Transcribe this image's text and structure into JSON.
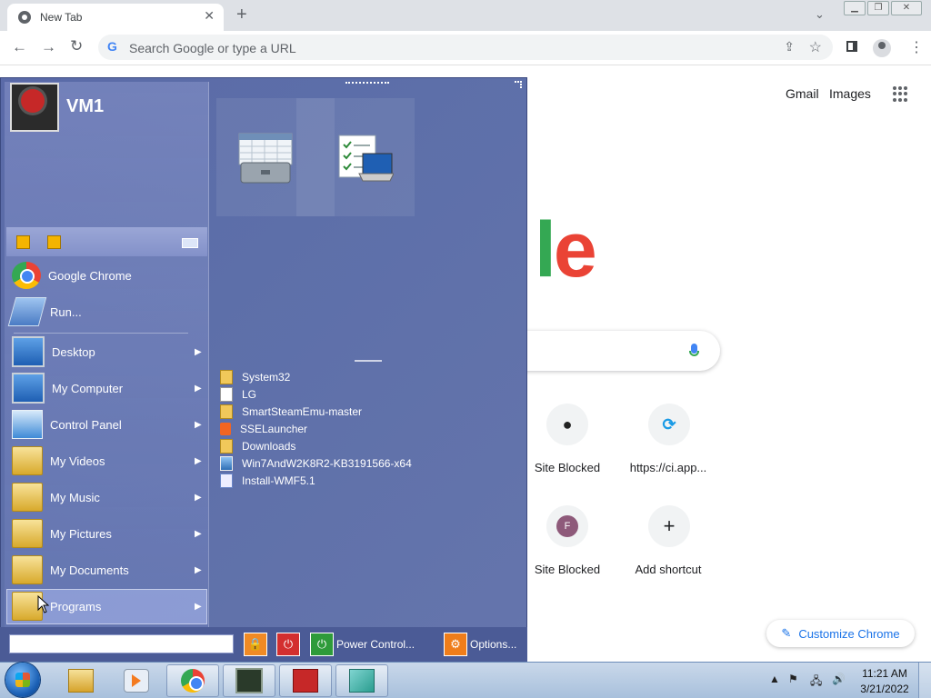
{
  "browser": {
    "tab_title": "New Tab",
    "new_tab": "+",
    "omnibox_placeholder": "Search Google or type a URL"
  },
  "google": {
    "links": [
      "Gmail",
      "Images"
    ],
    "logo_visible": "le",
    "shortcuts": [
      {
        "label": "Site Blocked",
        "icon": "github-icon"
      },
      {
        "label": "https://ci.app...",
        "icon": "app-icon"
      },
      {
        "label": "Site Blocked",
        "icon": "F"
      },
      {
        "label": "Add shortcut",
        "icon": "+"
      }
    ],
    "customize": "Customize Chrome"
  },
  "start_menu": {
    "user": "VM1",
    "pinned": [
      {
        "label": "Google Chrome",
        "icon": "chrome-icon"
      },
      {
        "label": "Run...",
        "icon": "run-icon"
      }
    ],
    "items": [
      {
        "label": "Desktop",
        "icon": "desktop-icon",
        "arrow": "▶"
      },
      {
        "label": "My Computer",
        "icon": "computer-icon",
        "arrow": "▶"
      },
      {
        "label": "Control Panel",
        "icon": "control-panel-icon",
        "arrow": "▶"
      },
      {
        "label": "My Videos",
        "icon": "folder-icon",
        "arrow": "▶"
      },
      {
        "label": "My Music",
        "icon": "folder-icon",
        "arrow": "▶"
      },
      {
        "label": "My Pictures",
        "icon": "folder-icon",
        "arrow": "▶"
      },
      {
        "label": "My Documents",
        "icon": "folder-icon",
        "arrow": "▶"
      },
      {
        "label": "Programs",
        "icon": "folder-icon",
        "arrow": "▶"
      }
    ],
    "recent": [
      {
        "label": "System32",
        "icon": "folder"
      },
      {
        "label": "LG",
        "icon": "file"
      },
      {
        "label": "SmartSteamEmu-master",
        "icon": "folder"
      },
      {
        "label": "SSELauncher",
        "icon": "rss"
      },
      {
        "label": "Downloads",
        "icon": "folder"
      },
      {
        "label": "Win7AndW2K8R2-KB3191566-x64",
        "icon": "pkg"
      },
      {
        "label": "Install-WMF5.1",
        "icon": "ps"
      }
    ],
    "power_control": "Power Control...",
    "options": "Options..."
  },
  "taskbar": {
    "time": "11:21 AM",
    "date": "3/21/2022",
    "tray_arrow": "▲"
  }
}
